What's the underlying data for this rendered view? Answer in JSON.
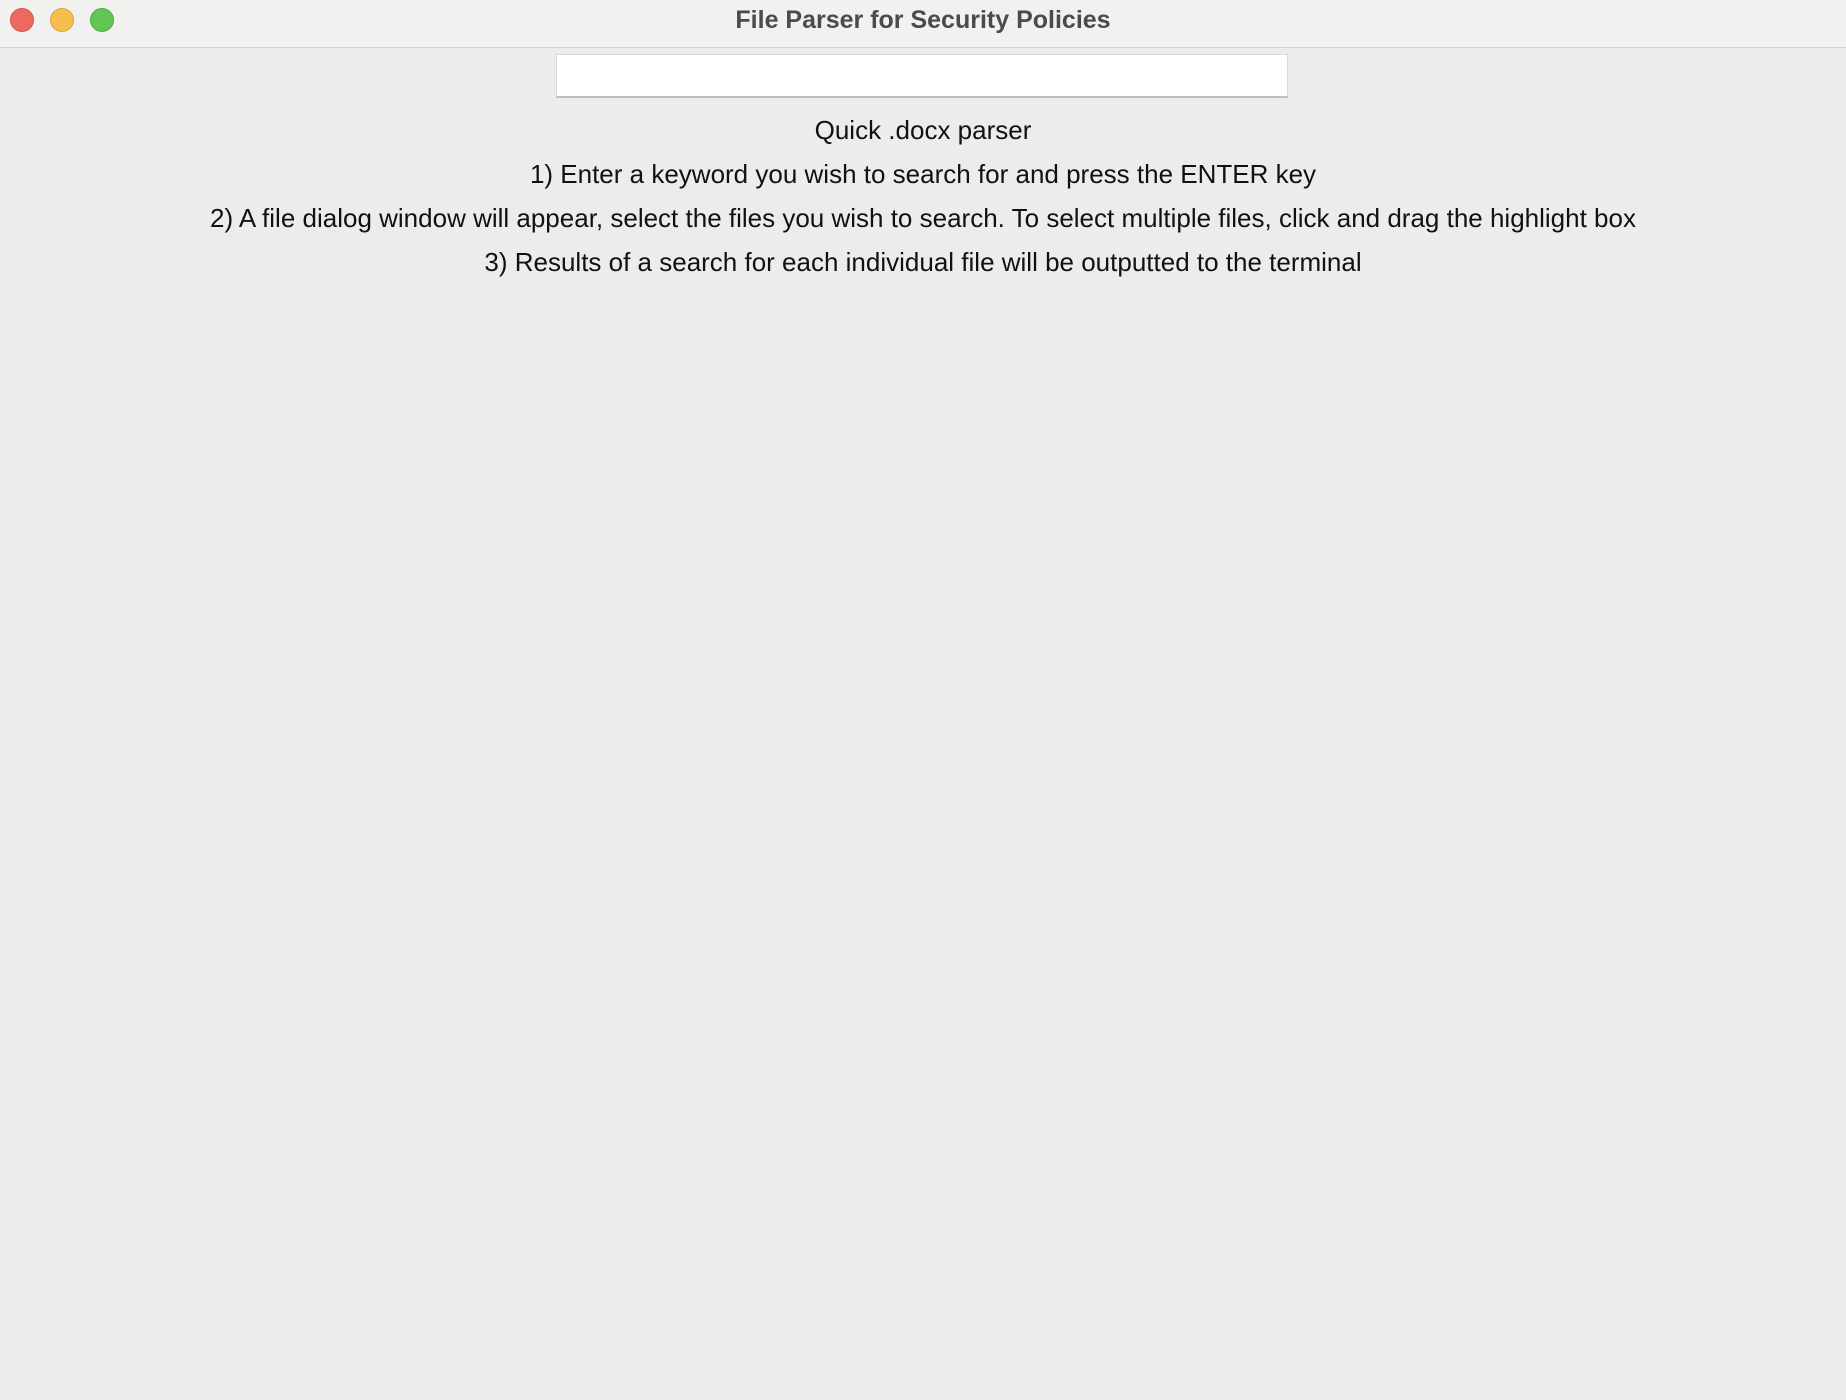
{
  "window": {
    "title": "File Parser for Security Policies"
  },
  "search": {
    "value": "",
    "placeholder": ""
  },
  "instructions": {
    "heading": "Quick .docx parser",
    "step1": "1) Enter a keyword you wish to search for and press the ENTER key",
    "step2": "2) A file dialog window will appear, select the files you wish to search. To select multiple files, click and drag the highlight box",
    "step3": "3) Results of a search for each individual file will be outputted to the terminal"
  },
  "colors": {
    "close": "#ee6a5e",
    "minimize": "#f5be4f",
    "zoom": "#62c655",
    "background": "#ececec"
  }
}
